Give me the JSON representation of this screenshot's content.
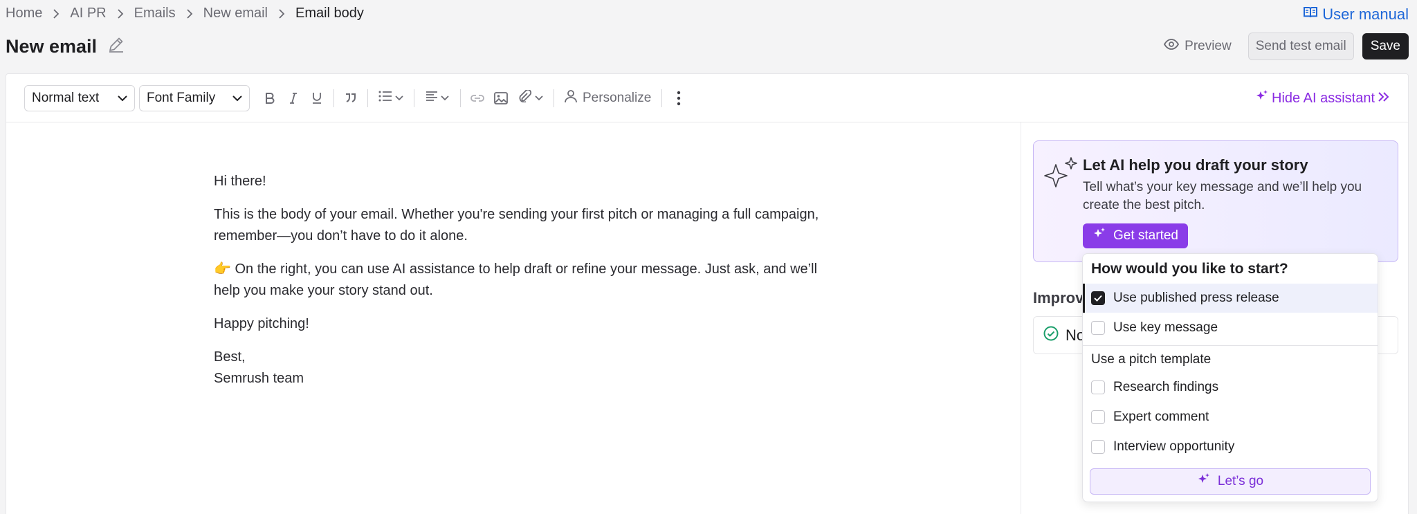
{
  "breadcrumb": {
    "items": [
      "Home",
      "AI PR",
      "Emails",
      "New email"
    ],
    "current": "Email body"
  },
  "header": {
    "title": "New email",
    "user_manual": "User manual",
    "preview": "Preview",
    "send_test": "Send test email",
    "save": "Save"
  },
  "toolbar": {
    "text_style": "Normal text",
    "font_family": "Font Family",
    "personalize": "Personalize",
    "hide_ai": "Hide AI assistant"
  },
  "editor": {
    "greeting": "Hi there!",
    "paragraph1": "This is the body of your email. Whether you're sending your first pitch or managing a full campaign, remember—you don’t have to do it alone.",
    "paragraph2": "👉 On the right, you can use AI assistance to help draft or refine your message. Just ask, and we’ll help you make your story stand out.",
    "closing": "Happy pitching!",
    "signoff": "Best,",
    "signature": "Semrush team"
  },
  "ai_panel": {
    "title": "Let AI help you draft your story",
    "text": "Tell what’s your key message and we’ll help you create the best pitch.",
    "get_started": "Get started",
    "improve_heading_visible": "Improv",
    "no_issues_visible": "No"
  },
  "dropdown": {
    "heading": "How would you like to start?",
    "options": [
      {
        "label": "Use published press release",
        "checked": true
      },
      {
        "label": "Use key message",
        "checked": false
      }
    ],
    "group_label": "Use a pitch template",
    "templates": [
      {
        "label": "Research findings",
        "checked": false
      },
      {
        "label": "Expert comment",
        "checked": false
      },
      {
        "label": "Interview opportunity",
        "checked": false
      }
    ],
    "action": "Let’s go"
  },
  "colors": {
    "accent_purple": "#8a3ce8",
    "link_blue": "#1e67d8",
    "success_green": "#1a9e6a",
    "dark": "#1f1f22"
  }
}
